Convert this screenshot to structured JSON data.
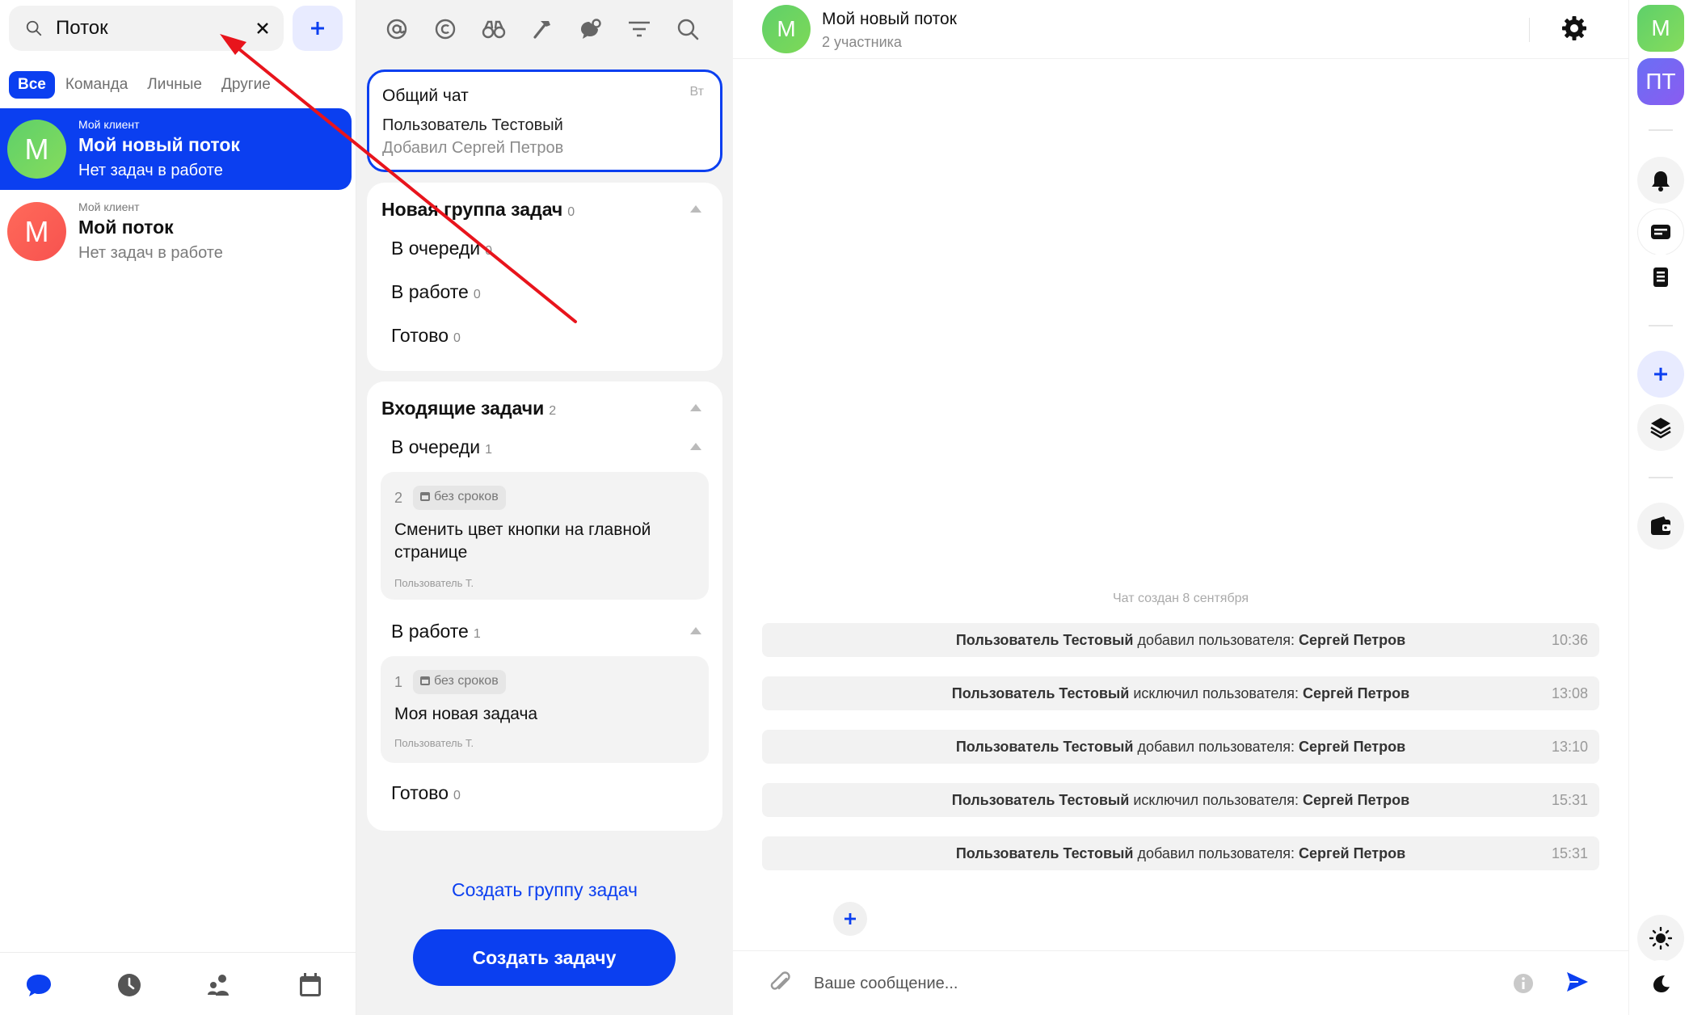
{
  "search": {
    "value": "Поток",
    "placeholder": ""
  },
  "filters": [
    "Все",
    "Команда",
    "Личные",
    "Другие"
  ],
  "streams": [
    {
      "client": "Мой клиент",
      "name": "Мой новый поток",
      "status": "Нет задач в работе",
      "avatar": "M",
      "selected": true
    },
    {
      "client": "Мой клиент",
      "name": "Мой поток",
      "status": "Нет задач в работе",
      "avatar": "M",
      "selected": false
    }
  ],
  "chat_card": {
    "title": "Общий чат",
    "day": "Вт",
    "line1": "Пользователь Тестовый",
    "line2": "Добавил Сергей Петров"
  },
  "group1": {
    "title": "Новая группа задач",
    "count": "0",
    "statuses": [
      {
        "label": "В очереди",
        "count": "0"
      },
      {
        "label": "В работе",
        "count": "0"
      },
      {
        "label": "Готово",
        "count": "0"
      }
    ]
  },
  "group2": {
    "title": "Входящие задачи",
    "count": "2",
    "queue": {
      "label": "В очереди",
      "count": "1"
    },
    "in_progress": {
      "label": "В работе",
      "count": "1"
    },
    "done": {
      "label": "Готово",
      "count": "0"
    },
    "tasks": [
      {
        "num": "2",
        "badge": "без сроков",
        "title": "Сменить цвет кнопки на главной странице",
        "author": "Пользователь Т."
      },
      {
        "num": "1",
        "badge": "без сроков",
        "title": "Моя новая задача",
        "author": "Пользователь Т."
      }
    ]
  },
  "create_group_label": "Создать группу задач",
  "create_task_label": "Создать задачу",
  "chat": {
    "avatar": "M",
    "name": "Мой новый поток",
    "members": "2 участника",
    "created": "Чат создан 8 сентября",
    "messages": [
      {
        "actor": "Пользователь Тестовый",
        "action": " добавил пользователя: ",
        "target": "Сергей Петров",
        "time": "10:36"
      },
      {
        "actor": "Пользователь Тестовый",
        "action": " исключил пользователя: ",
        "target": "Сергей Петров",
        "time": "13:08"
      },
      {
        "actor": "Пользователь Тестовый",
        "action": " добавил пользователя: ",
        "target": "Сергей Петров",
        "time": "13:10"
      },
      {
        "actor": "Пользователь Тестовый",
        "action": " исключил пользователя: ",
        "target": "Сергей Петров",
        "time": "15:31"
      },
      {
        "actor": "Пользователь Тестовый",
        "action": " добавил пользователя: ",
        "target": "Сергей Петров",
        "time": "15:31"
      }
    ],
    "composer_placeholder": "Ваше сообщение..."
  },
  "rail": {
    "avatar1": "M",
    "avatar2": "ПТ"
  },
  "colors": {
    "accent": "#0b3ff0",
    "annotation": "#e8141c"
  },
  "icons": {
    "toolbar": [
      "at-icon",
      "copyright-icon",
      "binoculars-icon",
      "hammer-icon",
      "chat-settings-icon",
      "filter-icon",
      "search-icon"
    ],
    "left_nav": [
      "chat-icon",
      "clock-icon",
      "users-icon",
      "calendar-icon"
    ],
    "rail": [
      "bell-icon",
      "card-icon",
      "notebook-icon",
      "plus-icon",
      "layers-icon",
      "wallet-icon",
      "sun-icon",
      "moon-icon"
    ]
  }
}
